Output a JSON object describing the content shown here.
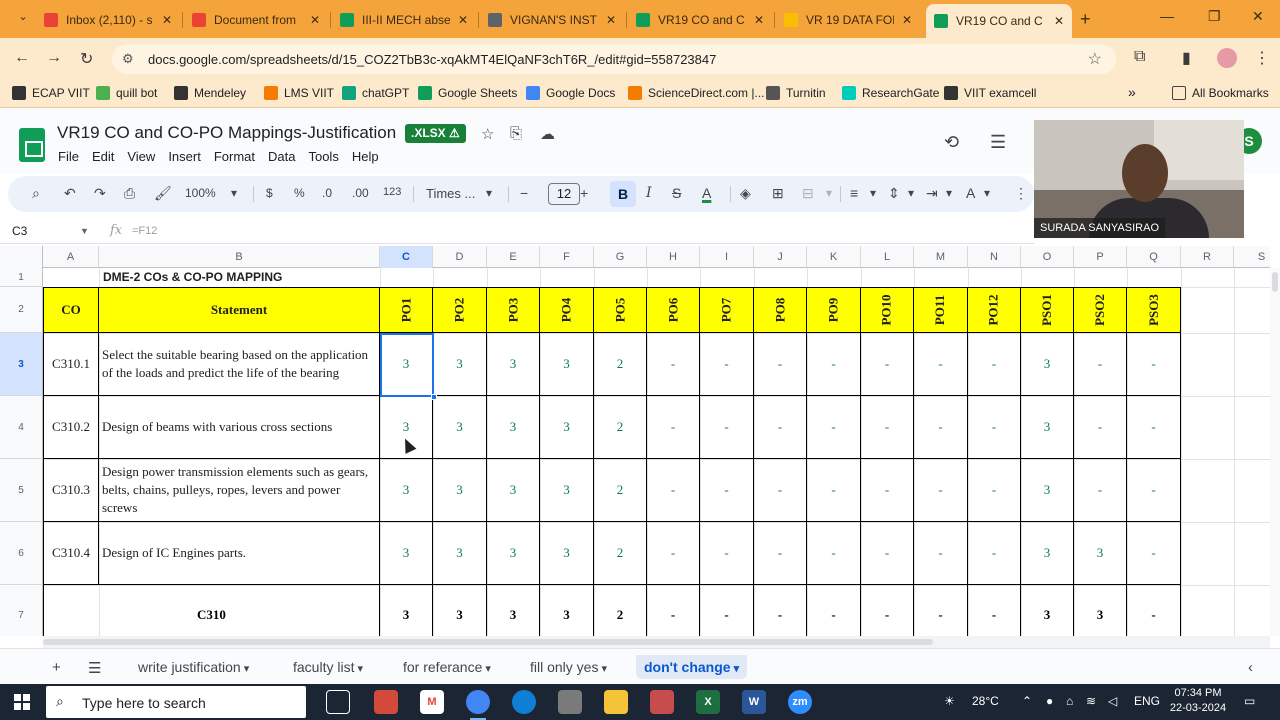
{
  "browser": {
    "tabs": [
      {
        "label": "Inbox (2,110) - s",
        "icon": "gmail-icon",
        "color": "#ea4335",
        "active": false
      },
      {
        "label": "Document from",
        "icon": "gmail-icon",
        "color": "#ea4335",
        "active": false
      },
      {
        "label": "III-II MECH abse",
        "icon": "sheets-icon",
        "color": "#0f9d58",
        "active": false
      },
      {
        "label": "VIGNAN'S INSTI",
        "icon": "globe-icon",
        "color": "#5f6368",
        "active": false
      },
      {
        "label": "VR19 CO and C",
        "icon": "sheets-icon",
        "color": "#0f9d58",
        "active": false
      },
      {
        "label": "VR 19 DATA FOF",
        "icon": "drive-icon",
        "color": "#fbbc04",
        "active": false
      },
      {
        "label": "VR19 CO and C",
        "icon": "sheets-icon",
        "color": "#0f9d58",
        "active": true
      }
    ],
    "url": "docs.google.com/spreadsheets/d/15_COZ2TbB3c-xqAkMT4ElQaNF3chT6R_/edit#gid=558723847",
    "bookmarks": [
      {
        "label": "ECAP VIIT",
        "color": "#333333"
      },
      {
        "label": "quill bot",
        "color": "#4caf50"
      },
      {
        "label": "Mendeley",
        "color": "#333333"
      },
      {
        "label": "LMS VIIT",
        "color": "#f57c00"
      },
      {
        "label": "chatGPT",
        "color": "#10a37f"
      },
      {
        "label": "Google Sheets",
        "color": "#0f9d58"
      },
      {
        "label": "Google Docs",
        "color": "#4285f4"
      },
      {
        "label": "ScienceDirect.com |...",
        "color": "#f57c00"
      },
      {
        "label": "Turnitin",
        "color": "#555555"
      },
      {
        "label": "ResearchGate",
        "color": "#00ccbb"
      },
      {
        "label": "VIIT examcell",
        "color": "#333333"
      }
    ],
    "all_bookmarks": "All Bookmarks",
    "overflow": "»"
  },
  "sheets": {
    "title": "VR19 CO and CO-PO Mappings-Justification",
    "badge": ".XLSX ⚠",
    "menu": [
      "File",
      "Edit",
      "View",
      "Insert",
      "Format",
      "Data",
      "Tools",
      "Help"
    ],
    "toolbar": {
      "zoom": "100%",
      "currency": "$",
      "percent": "%",
      "dec_decrease": ".0",
      "dec_increase": ".00",
      "number_format": "123",
      "font": "Times ...",
      "font_size": "12",
      "bold": "B",
      "italic": "I"
    },
    "name_box": "C3",
    "formula": "=F12",
    "share_initial": "S"
  },
  "webcam": {
    "name": "SURADA SANYASIRAO"
  },
  "grid": {
    "columns": [
      "A",
      "B",
      "C",
      "D",
      "E",
      "F",
      "G",
      "H",
      "I",
      "J",
      "K",
      "L",
      "M",
      "N",
      "O",
      "P",
      "Q",
      "R",
      "S"
    ],
    "rows": [
      "1",
      "2",
      "3",
      "4",
      "5",
      "6",
      "7"
    ],
    "sheet_title": "DME-2 COs & CO-PO MAPPING",
    "header": {
      "co": "CO",
      "statement": "Statement",
      "pos": [
        "PO1",
        "PO2",
        "PO3",
        "PO4",
        "PO5",
        "PO6",
        "PO7",
        "PO8",
        "PO9",
        "PO10",
        "PO11",
        "PO12",
        "PSO1",
        "PSO2",
        "PSO3"
      ]
    },
    "body": [
      {
        "co": "C310.1",
        "statement": "Select the suitable bearing based on the application of the loads and predict the life of the bearing",
        "values": [
          "3",
          "3",
          "3",
          "3",
          "2",
          "-",
          "-",
          "-",
          "-",
          "-",
          "-",
          "-",
          "3",
          "-",
          "-"
        ]
      },
      {
        "co": "C310.2",
        "statement": "Design of beams with various cross sections",
        "values": [
          "3",
          "3",
          "3",
          "3",
          "2",
          "-",
          "-",
          "-",
          "-",
          "-",
          "-",
          "-",
          "3",
          "-",
          "-"
        ]
      },
      {
        "co": "C310.3",
        "statement": "Design power transmission elements such as gears, belts, chains, pulleys, ropes, levers and power screws",
        "values": [
          "3",
          "3",
          "3",
          "3",
          "2",
          "-",
          "-",
          "-",
          "-",
          "-",
          "-",
          "-",
          "3",
          "-",
          "-"
        ]
      },
      {
        "co": "C310.4",
        "statement": "Design of IC Engines parts.",
        "values": [
          "3",
          "3",
          "3",
          "3",
          "2",
          "-",
          "-",
          "-",
          "-",
          "-",
          "-",
          "-",
          "3",
          "3",
          "-"
        ]
      }
    ],
    "total": {
      "co": "C310",
      "values": [
        "3",
        "3",
        "3",
        "3",
        "2",
        "-",
        "-",
        "-",
        "-",
        "-",
        "-",
        "-",
        "3",
        "3",
        "-"
      ]
    }
  },
  "sheet_tabs": [
    {
      "label": "write justification",
      "active": false
    },
    {
      "label": "faculty list",
      "active": false
    },
    {
      "label": "for referance",
      "active": false
    },
    {
      "label": "fill only yes",
      "active": false
    },
    {
      "label": "don't change",
      "active": true
    }
  ],
  "taskbar": {
    "search_placeholder": "Type here to search",
    "weather": "28°C",
    "language": "ENG",
    "time": "07:34 PM",
    "date": "22-03-2024"
  }
}
